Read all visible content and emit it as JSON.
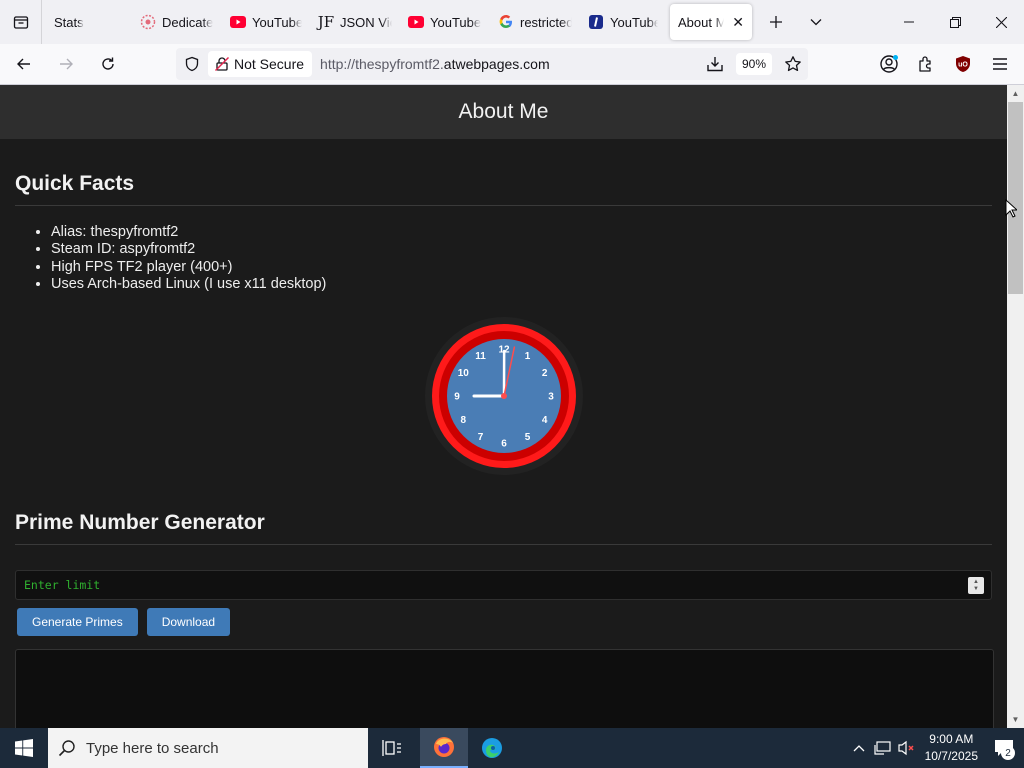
{
  "browser": {
    "tabs": [
      {
        "label": "Stats",
        "icon": "none"
      },
      {
        "label": "Dedicate",
        "icon": "dedicated-icon"
      },
      {
        "label": "YouTube",
        "icon": "youtube-icon"
      },
      {
        "label": "JSON Vie",
        "icon": "json-icon"
      },
      {
        "label": "YouTube",
        "icon": "youtube-icon"
      },
      {
        "label": "restricted",
        "icon": "google-icon"
      },
      {
        "label": "YouTube",
        "icon": "invidious-icon"
      },
      {
        "label": "About Me",
        "icon": "none",
        "active": true
      }
    ],
    "security_label": "Not Secure",
    "url_prefix": "http://",
    "url_host_dim": "thespyfromtf2.",
    "url_host": "atwebpages.com",
    "zoom": "90%"
  },
  "page": {
    "header_title": "About Me",
    "quick_facts": {
      "heading": "Quick Facts",
      "items": [
        "Alias: thespyfromtf2",
        "Steam ID: aspyfromtf2",
        "High FPS TF2 player (400+)",
        "Uses Arch-based Linux (I use x11 desktop)"
      ]
    },
    "clock": {
      "numbers": [
        "12",
        "1",
        "2",
        "3",
        "4",
        "5",
        "6",
        "7",
        "8",
        "9",
        "10",
        "11"
      ],
      "hours": 9,
      "minutes": 0,
      "seconds": 2,
      "ring_color": "#ff1a1a",
      "face_color": "#4a7db5"
    },
    "prime_generator": {
      "heading": "Prime Number Generator",
      "input_placeholder": "Enter limit",
      "generate_label": "Generate Primes",
      "download_label": "Download"
    }
  },
  "taskbar": {
    "search_placeholder": "Type here to search",
    "time": "9:00 AM",
    "date": "10/7/2025",
    "notification_count": "2"
  }
}
